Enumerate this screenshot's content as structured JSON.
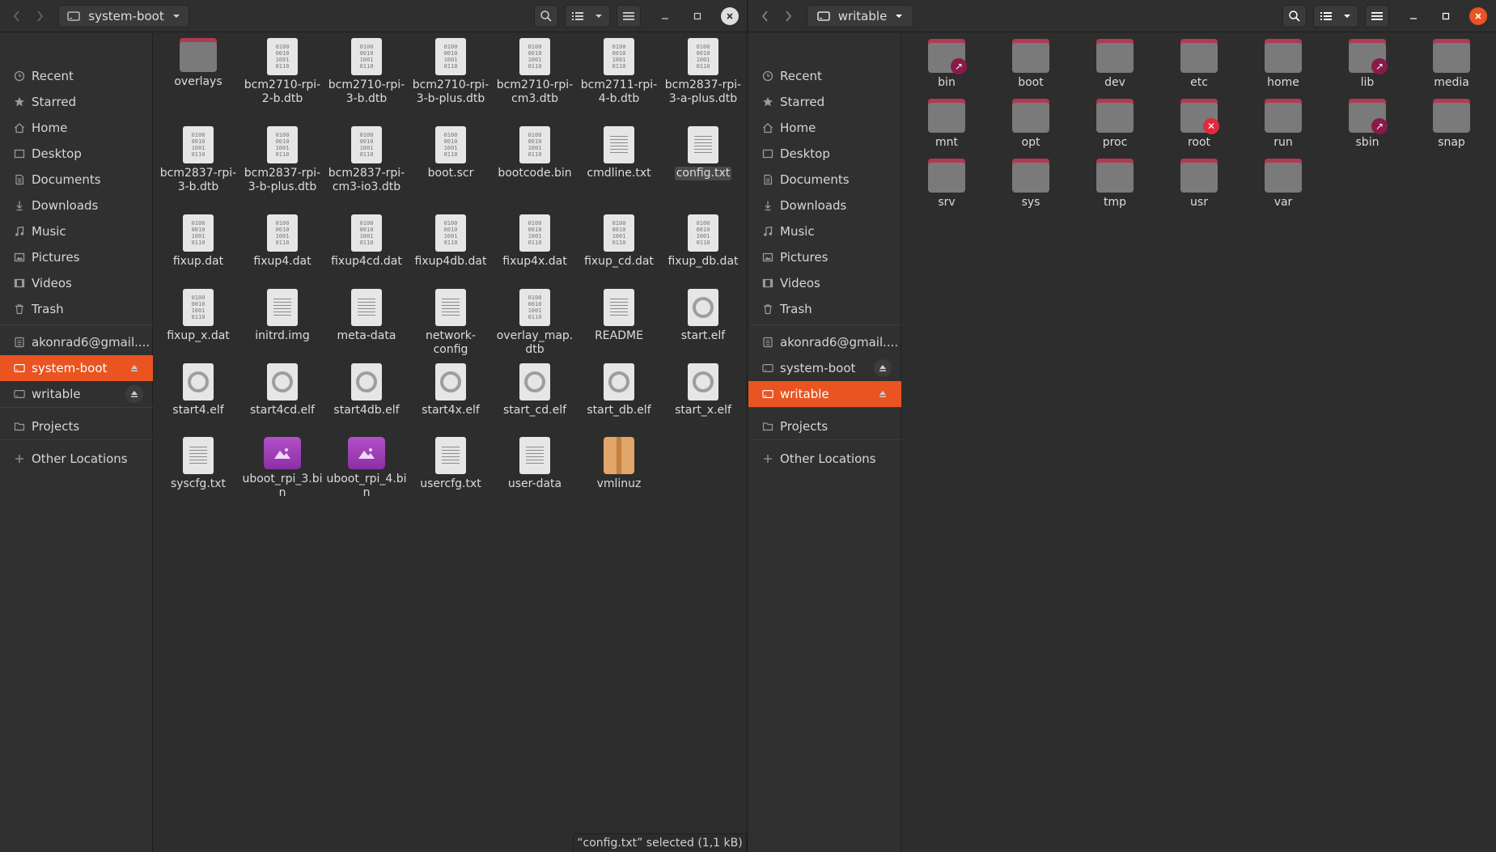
{
  "left_window": {
    "location": "system-boot",
    "status_text": "“config.txt” selected  (1,1 kB)",
    "sidebar": [
      {
        "label": "Recent",
        "icon": "clock-icon"
      },
      {
        "label": "Starred",
        "icon": "star-icon"
      },
      {
        "label": "Home",
        "icon": "home-icon"
      },
      {
        "label": "Desktop",
        "icon": "desktop-icon"
      },
      {
        "label": "Documents",
        "icon": "document-icon"
      },
      {
        "label": "Downloads",
        "icon": "download-icon"
      },
      {
        "label": "Music",
        "icon": "music-icon"
      },
      {
        "label": "Pictures",
        "icon": "pictures-icon"
      },
      {
        "label": "Videos",
        "icon": "videos-icon"
      },
      {
        "label": "Trash",
        "icon": "trash-icon"
      },
      {
        "label": "akonrad6@gmail....",
        "icon": "network-account-icon"
      },
      {
        "label": "system-boot",
        "icon": "drive-icon",
        "active": true
      },
      {
        "label": "writable",
        "icon": "drive-icon"
      },
      {
        "label": "Projects",
        "icon": "folder-icon"
      },
      {
        "label": "Other Locations",
        "icon": "plus-icon"
      }
    ],
    "files": [
      {
        "name": "overlays",
        "type": "folder"
      },
      {
        "name": "bcm2710-rpi-2-b.dtb",
        "type": "binary"
      },
      {
        "name": "bcm2710-rpi-3-b.dtb",
        "type": "binary"
      },
      {
        "name": "bcm2710-rpi-3-b-plus.dtb",
        "type": "binary"
      },
      {
        "name": "bcm2710-rpi-cm3.dtb",
        "type": "binary"
      },
      {
        "name": "bcm2711-rpi-4-b.dtb",
        "type": "binary"
      },
      {
        "name": "bcm2837-rpi-3-a-plus.dtb",
        "type": "binary"
      },
      {
        "name": "bcm2837-rpi-3-b.dtb",
        "type": "binary"
      },
      {
        "name": "bcm2837-rpi-3-b-plus.dtb",
        "type": "binary"
      },
      {
        "name": "bcm2837-rpi-cm3-io3.dtb",
        "type": "binary"
      },
      {
        "name": "boot.scr",
        "type": "binary"
      },
      {
        "name": "bootcode.bin",
        "type": "binary"
      },
      {
        "name": "cmdline.txt",
        "type": "text"
      },
      {
        "name": "config.txt",
        "type": "text",
        "selected": true
      },
      {
        "name": "fixup.dat",
        "type": "binary"
      },
      {
        "name": "fixup4.dat",
        "type": "binary"
      },
      {
        "name": "fixup4cd.dat",
        "type": "binary"
      },
      {
        "name": "fixup4db.dat",
        "type": "binary"
      },
      {
        "name": "fixup4x.dat",
        "type": "binary"
      },
      {
        "name": "fixup_cd.dat",
        "type": "binary"
      },
      {
        "name": "fixup_db.dat",
        "type": "binary"
      },
      {
        "name": "fixup_x.dat",
        "type": "binary"
      },
      {
        "name": "initrd.img",
        "type": "text"
      },
      {
        "name": "meta-data",
        "type": "text"
      },
      {
        "name": "network-config",
        "type": "text"
      },
      {
        "name": "overlay_map.dtb",
        "type": "binary"
      },
      {
        "name": "README",
        "type": "text"
      },
      {
        "name": "start.elf",
        "type": "executable"
      },
      {
        "name": "start4.elf",
        "type": "executable"
      },
      {
        "name": "start4cd.elf",
        "type": "executable"
      },
      {
        "name": "start4db.elf",
        "type": "executable"
      },
      {
        "name": "start4x.elf",
        "type": "executable"
      },
      {
        "name": "start_cd.elf",
        "type": "executable"
      },
      {
        "name": "start_db.elf",
        "type": "executable"
      },
      {
        "name": "start_x.elf",
        "type": "executable"
      },
      {
        "name": "syscfg.txt",
        "type": "text"
      },
      {
        "name": "uboot_rpi_3.bin",
        "type": "image"
      },
      {
        "name": "uboot_rpi_4.bin",
        "type": "image"
      },
      {
        "name": "usercfg.txt",
        "type": "text"
      },
      {
        "name": "user-data",
        "type": "text"
      },
      {
        "name": "vmlinuz",
        "type": "package"
      }
    ]
  },
  "right_window": {
    "location": "writable",
    "sidebar": [
      {
        "label": "Recent",
        "icon": "clock-icon"
      },
      {
        "label": "Starred",
        "icon": "star-icon"
      },
      {
        "label": "Home",
        "icon": "home-icon"
      },
      {
        "label": "Desktop",
        "icon": "desktop-icon"
      },
      {
        "label": "Documents",
        "icon": "document-icon"
      },
      {
        "label": "Downloads",
        "icon": "download-icon"
      },
      {
        "label": "Music",
        "icon": "music-icon"
      },
      {
        "label": "Pictures",
        "icon": "pictures-icon"
      },
      {
        "label": "Videos",
        "icon": "videos-icon"
      },
      {
        "label": "Trash",
        "icon": "trash-icon"
      },
      {
        "label": "akonrad6@gmail....",
        "icon": "network-account-icon"
      },
      {
        "label": "system-boot",
        "icon": "drive-icon"
      },
      {
        "label": "writable",
        "icon": "drive-icon",
        "active": true
      },
      {
        "label": "Projects",
        "icon": "folder-icon"
      },
      {
        "label": "Other Locations",
        "icon": "plus-icon"
      }
    ],
    "files": [
      {
        "name": "bin",
        "emblem": "link"
      },
      {
        "name": "boot"
      },
      {
        "name": "dev"
      },
      {
        "name": "etc"
      },
      {
        "name": "home"
      },
      {
        "name": "lib",
        "emblem": "link"
      },
      {
        "name": "media"
      },
      {
        "name": "mnt"
      },
      {
        "name": "opt"
      },
      {
        "name": "proc"
      },
      {
        "name": "root",
        "emblem": "locked"
      },
      {
        "name": "run"
      },
      {
        "name": "sbin",
        "emblem": "link"
      },
      {
        "name": "snap"
      },
      {
        "name": "srv"
      },
      {
        "name": "sys"
      },
      {
        "name": "tmp"
      },
      {
        "name": "usr"
      },
      {
        "name": "var"
      }
    ]
  },
  "colors": {
    "accent": "#e95420",
    "folder_tab": "#b03a52",
    "background": "#2d2d2d"
  }
}
